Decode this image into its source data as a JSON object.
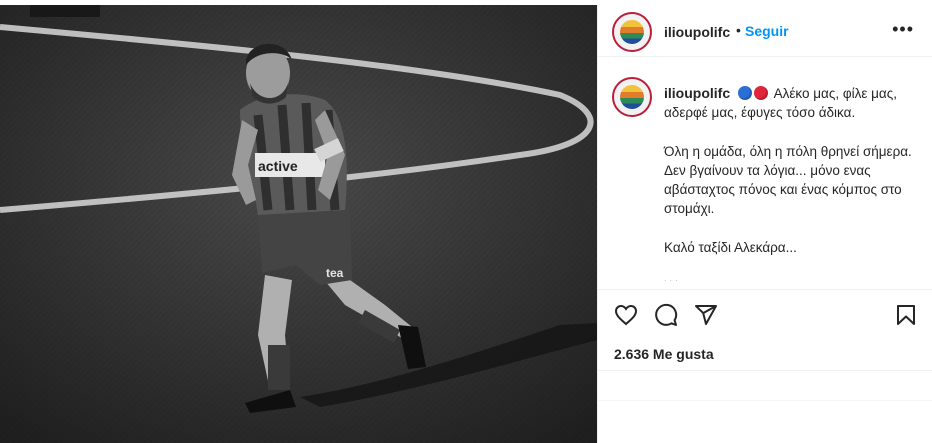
{
  "post": {
    "username": "ilioupolifc",
    "dot": "•",
    "follow_label": "Seguir",
    "more_label": "•••"
  },
  "caption": {
    "username": "ilioupolifc",
    "line1": "Αλέκο μας, φίλε μας, αδερφέ μας, έφυγες τόσο άδικα.",
    "line2": "Όλη η ομάδα, όλη η πόλη θρηνεί σήμερα. Δεν βγαίνουν τα λόγια... μόνο ενας αβάσταχτος πόνος και ένας κόμπος στο στομάχι.",
    "line3": "Καλό ταξίδι Αλεκάρα...",
    "faded": ". . ."
  },
  "engagement": {
    "likes_label": "2.636 Me gusta"
  },
  "photo": {
    "shirt_text": "active",
    "shorts_text": "tea"
  },
  "icons": {
    "like": "heart-icon",
    "comment": "comment-icon",
    "share": "send-icon",
    "save": "bookmark-icon"
  },
  "colors": {
    "link_blue": "#0095f6",
    "ball_blue": "#2a6fd6",
    "ball_red": "#e0243a"
  }
}
